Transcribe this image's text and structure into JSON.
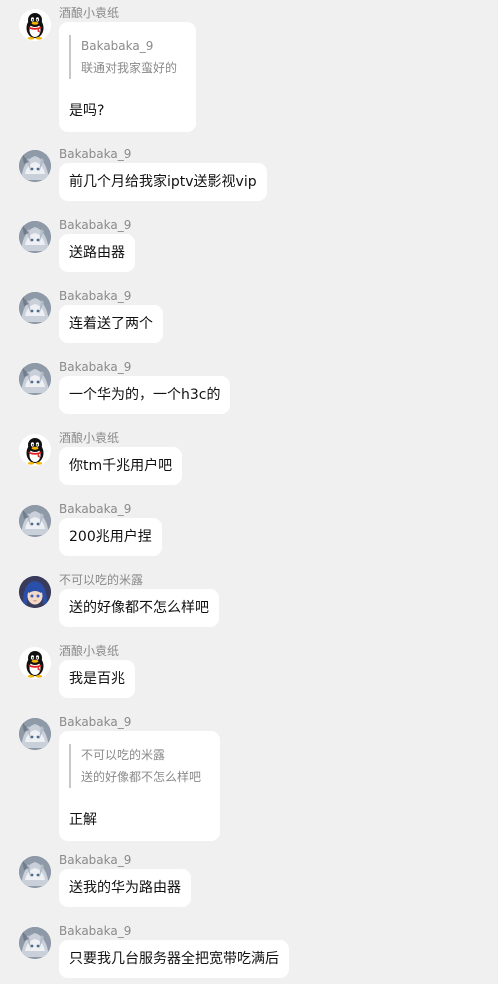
{
  "messages": [
    {
      "sender": "酒酿小袁纸",
      "avatar": "qq-penguin-avatar",
      "quote": {
        "author": "Bakabaka_9",
        "text": "联通对我家蛮好的"
      },
      "text": "是吗?"
    },
    {
      "sender": "Bakabaka_9",
      "avatar": "anime-avatar-silver",
      "text": "前几个月给我家iptv送影视vip"
    },
    {
      "sender": "Bakabaka_9",
      "avatar": "anime-avatar-silver",
      "text": "送路由器"
    },
    {
      "sender": "Bakabaka_9",
      "avatar": "anime-avatar-silver",
      "text": "连着送了两个"
    },
    {
      "sender": "Bakabaka_9",
      "avatar": "anime-avatar-silver",
      "text": "一个华为的，一个h3c的"
    },
    {
      "sender": "酒酿小袁纸",
      "avatar": "qq-penguin-avatar",
      "text": "你tm千兆用户吧"
    },
    {
      "sender": "Bakabaka_9",
      "avatar": "anime-avatar-silver",
      "text": "200兆用户捏"
    },
    {
      "sender": "不可以吃的米露",
      "avatar": "anime-avatar-blue",
      "text": "送的好像都不怎么样吧"
    },
    {
      "sender": "酒酿小袁纸",
      "avatar": "qq-penguin-avatar",
      "text": "我是百兆"
    },
    {
      "sender": "Bakabaka_9",
      "avatar": "anime-avatar-silver",
      "quote": {
        "author": "不可以吃的米露",
        "text": "送的好像都不怎么样吧"
      },
      "text": "正解"
    },
    {
      "sender": "Bakabaka_9",
      "avatar": "anime-avatar-silver",
      "text": "送我的华为路由器"
    },
    {
      "sender": "Bakabaka_9",
      "avatar": "anime-avatar-silver",
      "text": "只要我几台服务器全把宽带吃满后"
    }
  ]
}
